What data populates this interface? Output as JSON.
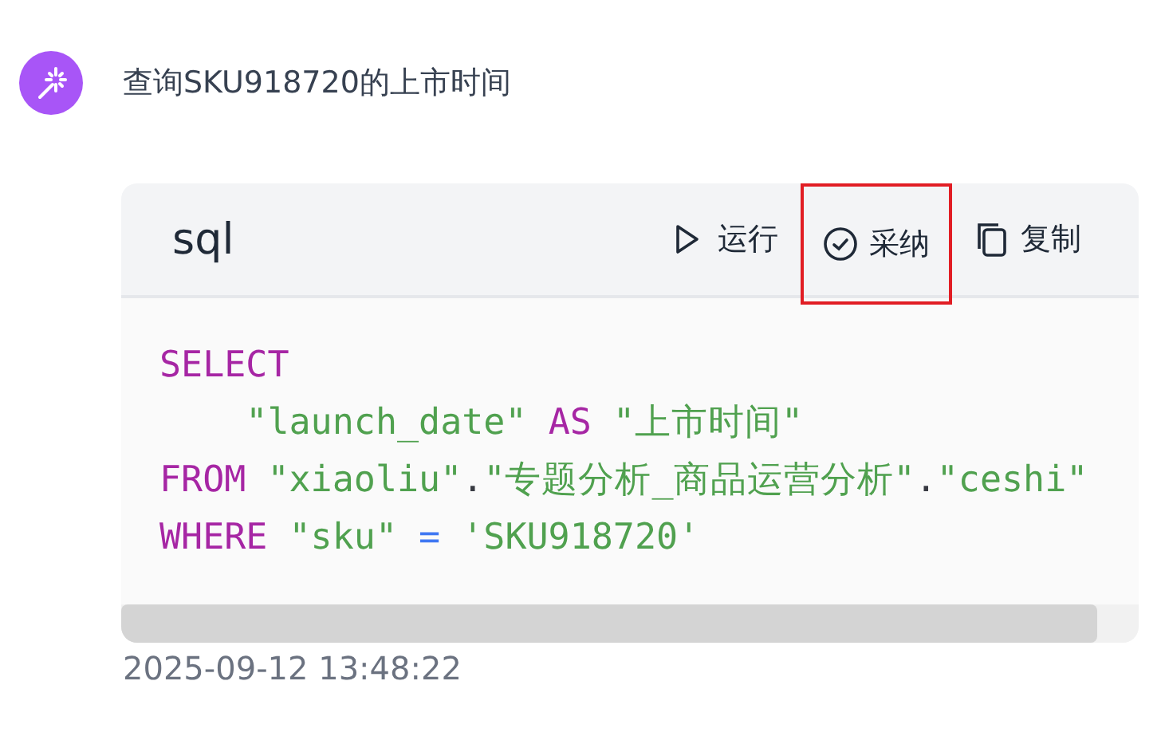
{
  "message": {
    "text": "查询SKU918720的上市时间"
  },
  "code_block": {
    "language": "sql",
    "actions": [
      {
        "kind": "run",
        "label": "运行",
        "highlighted": false
      },
      {
        "kind": "accept",
        "label": "采纳",
        "highlighted": true
      },
      {
        "kind": "copy",
        "label": "复制",
        "highlighted": false
      }
    ],
    "lines": [
      {
        "indented": false,
        "tokens": [
          {
            "kind": "keyword",
            "text": "SELECT",
            "space_before": false
          }
        ]
      },
      {
        "indented": true,
        "tokens": [
          {
            "kind": "string",
            "text": "\"launch_date\"",
            "space_before": false
          },
          {
            "kind": "keyword",
            "text": "AS",
            "space_before": true
          },
          {
            "kind": "string",
            "text": "\"上市时间\"",
            "space_before": true
          }
        ]
      },
      {
        "indented": false,
        "tokens": [
          {
            "kind": "keyword",
            "text": "FROM",
            "space_before": false
          },
          {
            "kind": "string",
            "text": "\"xiaoliu\"",
            "space_before": true
          },
          {
            "kind": "plain",
            "text": ".",
            "space_before": false
          },
          {
            "kind": "string",
            "text": "\"专题分析_商品运营分析\"",
            "space_before": false
          },
          {
            "kind": "plain",
            "text": ".",
            "space_before": false
          },
          {
            "kind": "string",
            "text": "\"ceshi\"",
            "space_before": false
          }
        ]
      },
      {
        "indented": false,
        "tokens": [
          {
            "kind": "keyword",
            "text": "WHERE",
            "space_before": false
          },
          {
            "kind": "string",
            "text": "\"sku\"",
            "space_before": true
          },
          {
            "kind": "operator",
            "text": "=",
            "space_before": true
          },
          {
            "kind": "string",
            "text": "'SKU918720'",
            "space_before": true
          }
        ]
      }
    ]
  },
  "timestamp": "2025-09-12 13:48:22"
}
